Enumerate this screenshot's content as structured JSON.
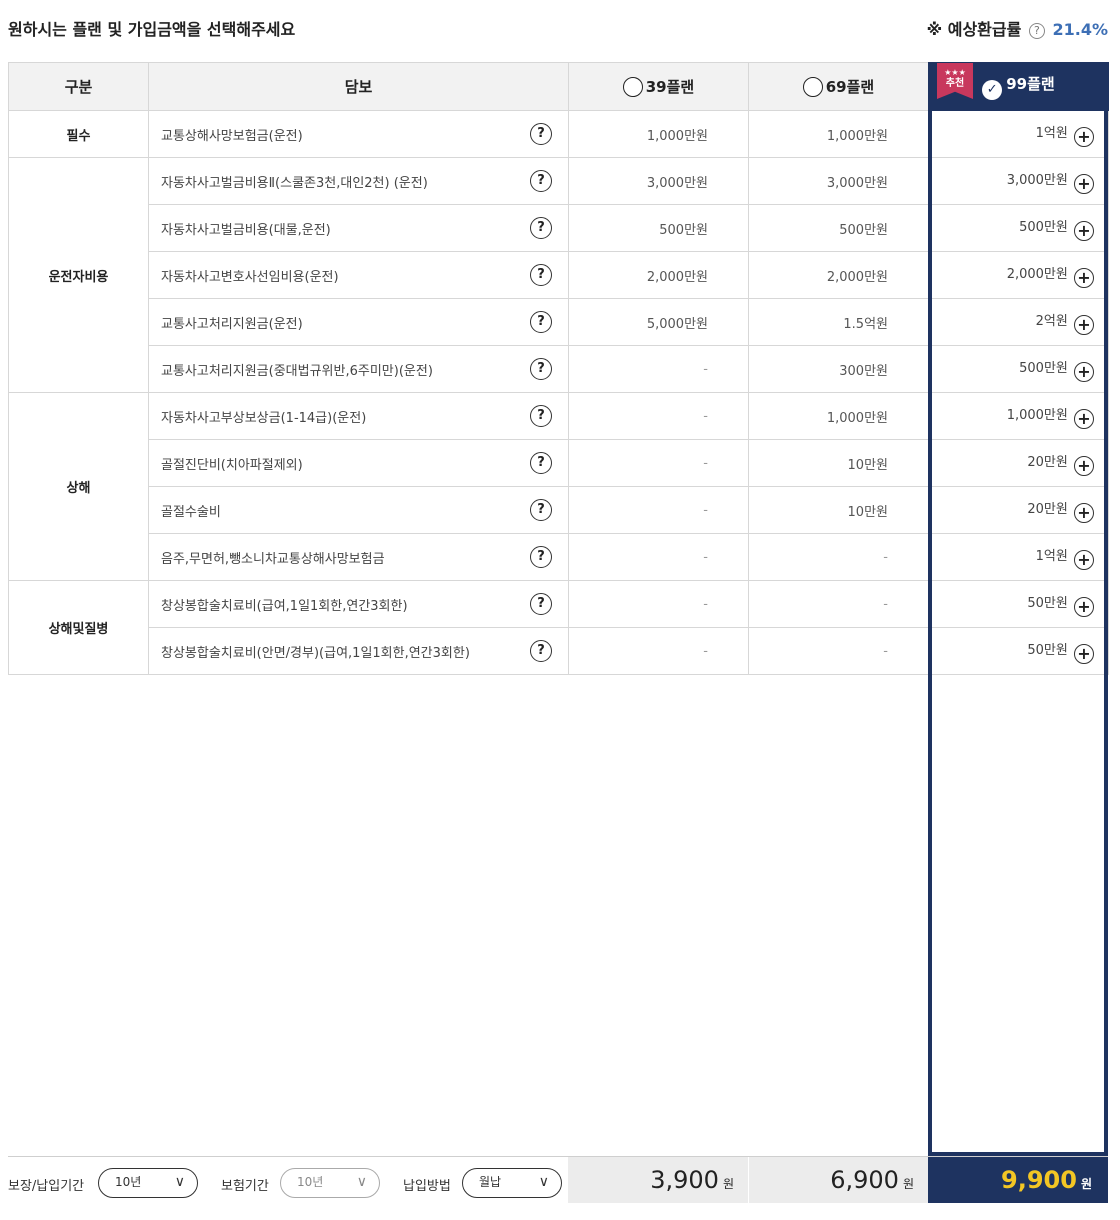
{
  "header": {
    "title": "원하시는 플랜 및 가입금액을 선택해주세요",
    "rate_label": "※ 예상환급률",
    "rate_help": "?",
    "rate_value": "21.4%"
  },
  "table": {
    "columns": [
      "구분",
      "담보",
      "39플랜",
      "69플랜",
      "99플랜"
    ],
    "badge": {
      "stars": "★★★",
      "text": "추천"
    },
    "rows": [
      {
        "cov": "교통상해사망보험금(운전)",
        "p39": "1,000만원",
        "p69": "1,000만원",
        "p99": "1억원"
      },
      {
        "cov": "자동차사고벌금비용Ⅱ(스쿨존3천,대인2천) (운전)",
        "p39": "3,000만원",
        "p69": "3,000만원",
        "p99": "3,000만원"
      },
      {
        "cov": "자동차사고벌금비용(대물,운전)",
        "p39": "500만원",
        "p69": "500만원",
        "p99": "500만원"
      },
      {
        "cov": "자동차사고변호사선임비용(운전)",
        "p39": "2,000만원",
        "p69": "2,000만원",
        "p99": "2,000만원"
      },
      {
        "cov": "교통사고처리지원금(운전)",
        "p39": "5,000만원",
        "p69": "1.5억원",
        "p99": "2억원"
      },
      {
        "cov": "교통사고처리지원금(중대법규위반,6주미만)(운전)",
        "p39": "-",
        "p69": "300만원",
        "p99": "500만원"
      },
      {
        "cov": "자동차사고부상보상금(1-14급)(운전)",
        "p39": "-",
        "p69": "1,000만원",
        "p99": "1,000만원"
      },
      {
        "cov": "골절진단비(치아파절제외)",
        "p39": "-",
        "p69": "10만원",
        "p99": "20만원"
      },
      {
        "cov": "골절수술비",
        "p39": "-",
        "p69": "10만원",
        "p99": "20만원"
      },
      {
        "cov": "음주,무면허,뺑소니차교통상해사망보험금",
        "p39": "-",
        "p69": "-",
        "p99": "1억원"
      },
      {
        "cov": "창상봉합술치료비(급여,1일1회한,연간3회한)",
        "p39": "-",
        "p69": "-",
        "p99": "50만원"
      },
      {
        "cov": "창상봉합술치료비(안면/경부)(급여,1일1회한,연간3회한)",
        "p39": "-",
        "p69": "-",
        "p99": "50만원"
      }
    ],
    "categories": [
      "필수",
      "운전자비용",
      "상해",
      "상해및질병"
    ]
  },
  "footer": {
    "period_label": "보장/납입기간",
    "period_value": "10년",
    "insure_label": "보험기간",
    "insure_value": "10년",
    "pay_label": "납입방법",
    "pay_value": "월납",
    "price39": "3,900",
    "price69": "6,900",
    "price99": "9,900",
    "won": "원"
  },
  "colors": {
    "navy": "#1e3360",
    "accent_blue": "#3d6fb5",
    "badge": "#c8385d",
    "price_yellow": "#f3c624"
  },
  "icons": [
    "help-icon",
    "radio-icon",
    "check-icon",
    "plus-icon",
    "chevron-down-icon"
  ]
}
